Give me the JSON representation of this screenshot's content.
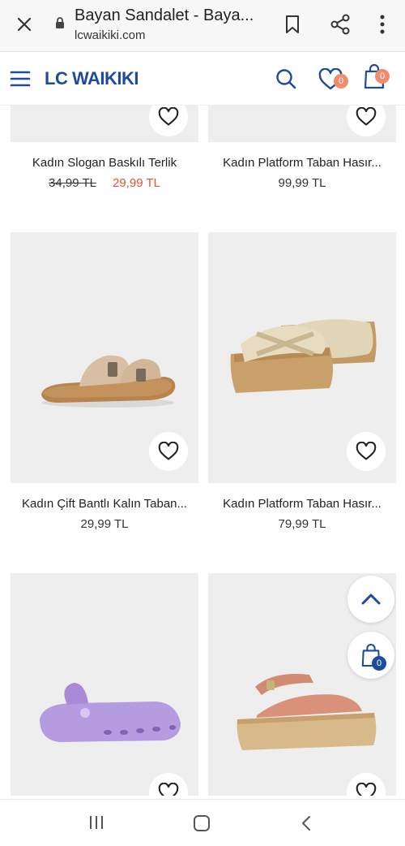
{
  "browser": {
    "page_title": "Bayan Sandalet - Baya...",
    "url": "lcwaikiki.com",
    "icons": [
      "close-icon",
      "lock-icon",
      "bookmark-icon",
      "share-icon",
      "more-icon"
    ]
  },
  "site": {
    "logo": "LC WAIKIKI",
    "favorites_count": "0",
    "cart_count": "0",
    "accent": "#1e4b9c",
    "badge_color": "#f28b6b"
  },
  "products": [
    {
      "name": "Kadın Slogan Baskılı Terlik",
      "old_price": "34,99 TL",
      "price": "29,99 TL"
    },
    {
      "name": "Kadın Platform Taban Hasır...",
      "price": "99,99 TL"
    },
    {
      "name": "Kadın Çift Bantlı Kalın Taban...",
      "price": "29,99 TL"
    },
    {
      "name": "Kadın Platform Taban Hasır...",
      "price": "79,99 TL"
    },
    {
      "name": "",
      "price": ""
    },
    {
      "name": "",
      "price": ""
    }
  ],
  "floating": {
    "cart_count": "0"
  },
  "colors": {
    "sale_price": "#e0533a"
  }
}
